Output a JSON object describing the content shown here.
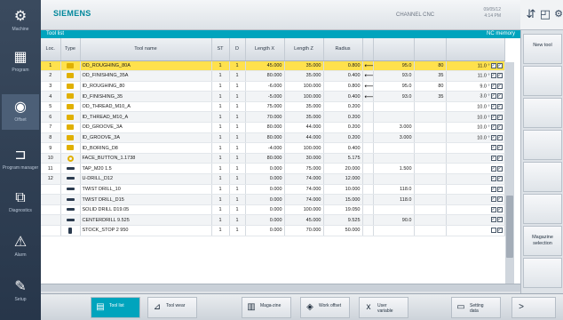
{
  "sidebar": {
    "items": [
      {
        "icon": "machine-icon",
        "glyph": "⚙",
        "label": "Machine"
      },
      {
        "icon": "program-icon",
        "glyph": "▦",
        "label": "Program"
      },
      {
        "icon": "offset-icon",
        "glyph": "◉",
        "label": "Offset"
      },
      {
        "icon": "program-manager-icon",
        "glyph": "⊐",
        "label": "Program manager"
      },
      {
        "icon": "diagnostics-icon",
        "glyph": "⧉",
        "label": "Diagnostics"
      },
      {
        "icon": "alarm-icon",
        "glyph": "⚠",
        "label": "Alarm"
      },
      {
        "icon": "setup-icon",
        "glyph": "✎",
        "label": "Setup"
      }
    ]
  },
  "header": {
    "brand": "SIEMENS",
    "channel": "CHANNEL CNC",
    "clock_line1": "09/05/12",
    "clock_line2": "4:14 PM"
  },
  "titlebar": {
    "title": "Tool list",
    "right": "NC memory"
  },
  "table": {
    "columns": [
      "Loc.",
      "Type",
      "Tool name",
      "ST",
      "D",
      "Length X",
      "Length Z",
      "Radius",
      "",
      "",
      "",
      ""
    ],
    "rows": [
      {
        "loc": "1",
        "icon": "rect",
        "name": "OD_ROUGHING_80A",
        "st": "1",
        "d": "1",
        "lx": "45.000",
        "lz": "35.000",
        "radius": "0.800",
        "arrow": "⟵",
        "a1": "95.0",
        "a2": "80",
        "a3": "11.0",
        "deg": "°",
        "chk1": "✓",
        "chk2": "✓",
        "selected": true
      },
      {
        "loc": "2",
        "icon": "rect",
        "name": "OD_FINISHING_35A",
        "st": "1",
        "d": "1",
        "lx": "80.000",
        "lz": "35.000",
        "radius": "0.400",
        "arrow": "⟵",
        "a1": "93.0",
        "a2": "35",
        "a3": "11.0",
        "deg": "°",
        "chk1": "✓",
        "chk2": "✓"
      },
      {
        "loc": "3",
        "icon": "rect",
        "name": "ID_ROUGHING_80",
        "st": "1",
        "d": "1",
        "lx": "-6.000",
        "lz": "100.000",
        "radius": "0.800",
        "arrow": "⟵",
        "a1": "95.0",
        "a2": "80",
        "a3": "9.0",
        "deg": "°",
        "chk1": "✓",
        "chk2": "✓"
      },
      {
        "loc": "4",
        "icon": "rect",
        "name": "ID_FINISHING_35",
        "st": "1",
        "d": "1",
        "lx": "-5.000",
        "lz": "100.000",
        "radius": "0.400",
        "arrow": "⟵",
        "a1": "93.0",
        "a2": "35",
        "a3": "3.0",
        "deg": "°",
        "chk1": "✓",
        "chk2": "✓"
      },
      {
        "loc": "5",
        "icon": "rect",
        "name": "OD_THREAD_M10_A",
        "st": "1",
        "d": "1",
        "lx": "75.000",
        "lz": "35.000",
        "radius": "0.200",
        "arrow": "",
        "a1": "",
        "a2": "",
        "a3": "10.0",
        "deg": "°",
        "chk1": "✓",
        "chk2": "✓"
      },
      {
        "loc": "6",
        "icon": "rect",
        "name": "ID_THREAD_M10_A",
        "st": "1",
        "d": "1",
        "lx": "70.000",
        "lz": "35.000",
        "radius": "0.200",
        "arrow": "",
        "a1": "",
        "a2": "",
        "a3": "10.0",
        "deg": "°",
        "chk1": "✓",
        "chk2": "✓"
      },
      {
        "loc": "7",
        "icon": "rect",
        "name": "OD_GROOVE_3A",
        "st": "1",
        "d": "1",
        "lx": "80.000",
        "lz": "44.000",
        "radius": "0.200",
        "arrow": "",
        "a1": "3.000",
        "a2": "",
        "a3": "10.0",
        "deg": "°",
        "chk1": "✓",
        "chk2": "✓"
      },
      {
        "loc": "8",
        "icon": "rect",
        "name": "ID_GROOVE_3A",
        "st": "1",
        "d": "1",
        "lx": "80.000",
        "lz": "44.000",
        "radius": "0.200",
        "arrow": "",
        "a1": "3.000",
        "a2": "",
        "a3": "10.0",
        "deg": "°",
        "chk1": "✓",
        "chk2": "✓"
      },
      {
        "loc": "9",
        "icon": "rect",
        "name": "ID_BORING_D8",
        "st": "1",
        "d": "1",
        "lx": "-4.000",
        "lz": "100.000",
        "radius": "0.400",
        "arrow": "",
        "a1": "",
        "a2": "",
        "a3": "",
        "deg": "",
        "chk1": "✓",
        "chk2": "✓"
      },
      {
        "loc": "10",
        "icon": "ring",
        "name": "FACE_BUTTON_1.1738",
        "st": "1",
        "d": "1",
        "lx": "80.000",
        "lz": "30.000",
        "radius": "5.175",
        "arrow": "",
        "a1": "",
        "a2": "",
        "a3": "",
        "deg": "",
        "chk1": "✓",
        "chk2": "✓"
      },
      {
        "loc": "11",
        "icon": "drill",
        "name": "TAP_M20 1.5",
        "st": "1",
        "d": "1",
        "lx": "0.000",
        "lz": "75.000",
        "radius": "20.000",
        "arrow": "",
        "a1": "1.500",
        "a2": "",
        "a3": "",
        "deg": "",
        "chk1": "✓",
        "chk2": "✓"
      },
      {
        "loc": "12",
        "icon": "drill",
        "name": "U-DRILL_D12",
        "st": "1",
        "d": "1",
        "lx": "0.000",
        "lz": "74.000",
        "radius": "12.000",
        "arrow": "",
        "a1": "",
        "a2": "",
        "a3": "",
        "deg": "",
        "chk1": "✓",
        "chk2": "✓"
      },
      {
        "loc": "",
        "icon": "drill",
        "name": "TWIST DRILL_10",
        "st": "1",
        "d": "1",
        "lx": "0.000",
        "lz": "74.000",
        "radius": "10.000",
        "arrow": "",
        "a1": "118.0",
        "a2": "",
        "a3": "",
        "deg": "",
        "chk1": "✓",
        "chk2": "✓"
      },
      {
        "loc": "",
        "icon": "drill",
        "name": "TWIST DRILL_D15",
        "st": "1",
        "d": "1",
        "lx": "0.000",
        "lz": "74.000",
        "radius": "15.000",
        "arrow": "",
        "a1": "118.0",
        "a2": "",
        "a3": "",
        "deg": "",
        "chk1": "✓",
        "chk2": "✓"
      },
      {
        "loc": "",
        "icon": "drill",
        "name": "SOLID DRILL D19.05",
        "st": "1",
        "d": "1",
        "lx": "0.000",
        "lz": "100.000",
        "radius": "19.050",
        "arrow": "",
        "a1": "",
        "a2": "",
        "a3": "",
        "deg": "",
        "chk1": "✓",
        "chk2": "✓"
      },
      {
        "loc": "",
        "icon": "drill",
        "name": "CENTERDRILL 9.525",
        "st": "1",
        "d": "1",
        "lx": "0.000",
        "lz": "45.000",
        "radius": "9.525",
        "arrow": "",
        "a1": "90.0",
        "a2": "",
        "a3": "",
        "deg": "",
        "chk1": "✓",
        "chk2": "✓"
      },
      {
        "loc": "",
        "icon": "stop",
        "name": "STOCK_STOP 2 950",
        "st": "1",
        "d": "1",
        "lx": "0.000",
        "lz": "70.000",
        "radius": "50.000",
        "arrow": "",
        "a1": "",
        "a2": "",
        "a3": "",
        "deg": "",
        "chk1": "",
        "chk2": "✓"
      }
    ]
  },
  "right_softkeys": [
    {
      "label": "New tool"
    },
    {
      "label": ""
    },
    {
      "label": ""
    },
    {
      "label": ""
    },
    {
      "label": ""
    },
    {
      "label": ""
    },
    {
      "label": "Magazine selection"
    },
    {
      "label": ""
    }
  ],
  "bottom_softkeys": [
    {
      "icon": "tool-list-icon",
      "glyph": "▤",
      "label": "Tool list",
      "active": true
    },
    {
      "icon": "tool-wear-icon",
      "glyph": "⊿",
      "label": "Tool wear"
    },
    {
      "icon": "magazine-icon",
      "glyph": "▥",
      "label": "Maga-zine"
    },
    {
      "icon": "work-offset-icon",
      "glyph": "◈",
      "label": "Work offset"
    },
    {
      "icon": "user-variable-icon",
      "glyph": "x",
      "label": "User variable"
    },
    {
      "icon": "setting-data-icon",
      "glyph": "▭",
      "label": "Setting data"
    },
    {
      "icon": "next-icon",
      "glyph": ">",
      "label": ""
    }
  ]
}
